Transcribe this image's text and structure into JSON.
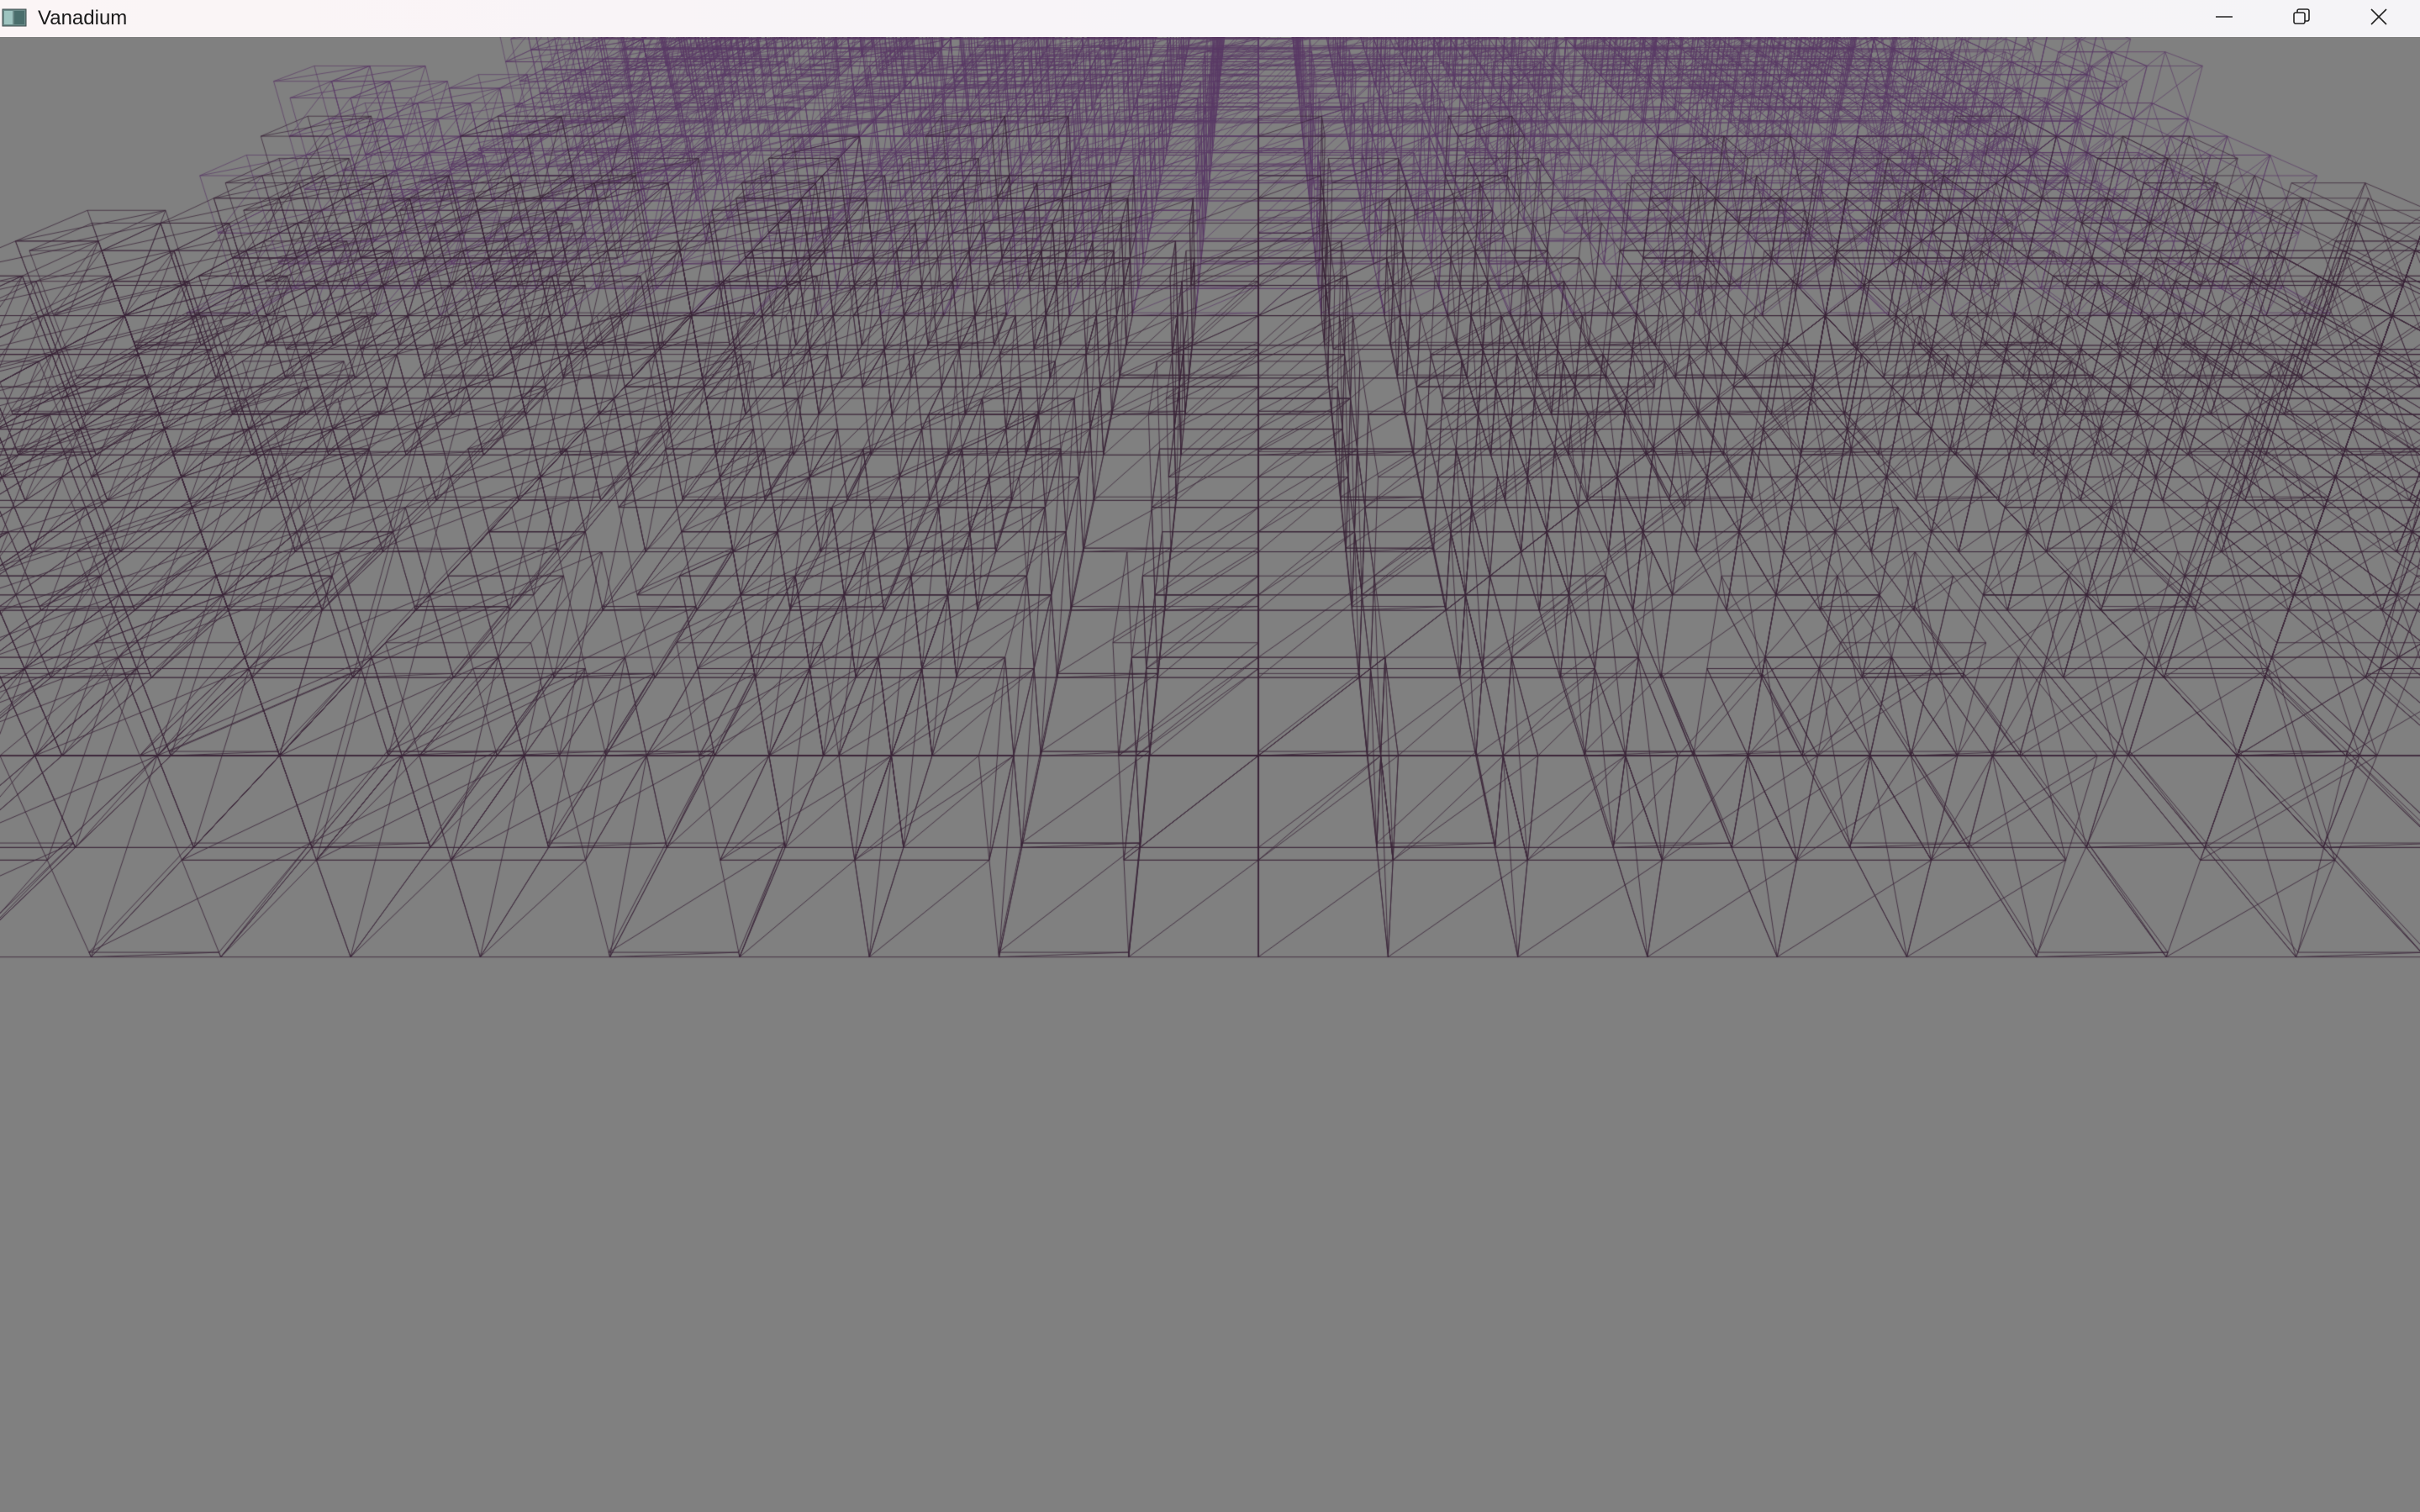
{
  "window": {
    "title": "Vanadium",
    "icon": "app-window-icon",
    "controls": {
      "minimize_icon": "minimize-icon",
      "maximize_icon": "restore-icon",
      "close_icon": "close-icon"
    }
  },
  "scene": {
    "description_icon": "wireframe-voxel-scene",
    "background_color": "#808080",
    "line_color": "#3a2438",
    "far_line_color": "#5a3a66"
  }
}
